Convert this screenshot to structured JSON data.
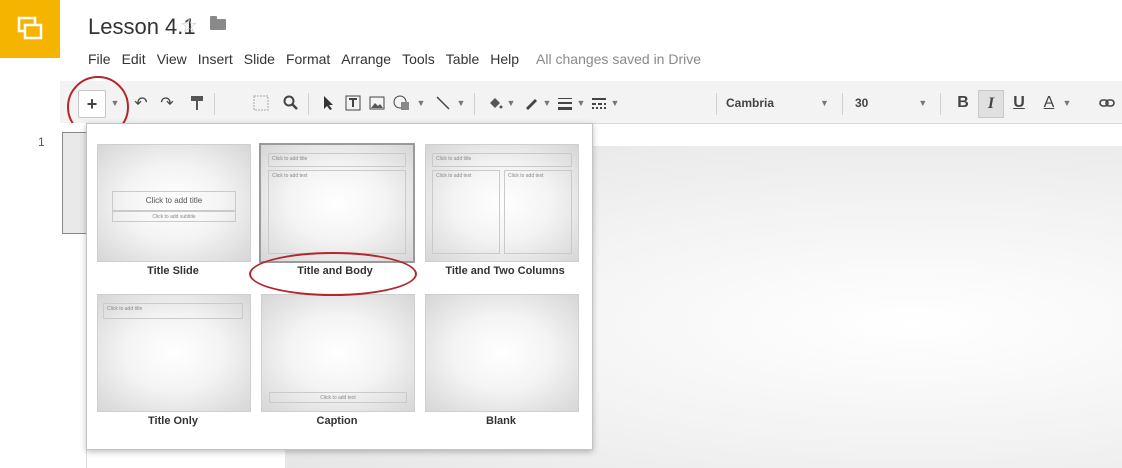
{
  "header": {
    "doc_title": "Lesson 4.1",
    "star_icon": "☆",
    "folder_icon": "folder-icon"
  },
  "menu": {
    "items": [
      "File",
      "Edit",
      "View",
      "Insert",
      "Slide",
      "Format",
      "Arrange",
      "Tools",
      "Table",
      "Help"
    ],
    "status": "All changes saved in Drive"
  },
  "toolbar": {
    "new_slide": "+",
    "undo": "↶",
    "redo": "↷",
    "font": "Cambria",
    "font_size": "30",
    "bold": "B",
    "italic": "I",
    "underline": "U",
    "text_color": "A"
  },
  "filmstrip": {
    "slide_number": "1"
  },
  "layouts": [
    {
      "name": "Title Slide",
      "title_placeholder": "Click to add title",
      "sub_placeholder": "Click to add subtitle"
    },
    {
      "name": "Title and Body",
      "title_placeholder": "Click to add title",
      "body_placeholder": "Click to add text"
    },
    {
      "name": "Title and Two Columns",
      "title_placeholder": "Click to add title",
      "col1_placeholder": "Click to add text",
      "col2_placeholder": "Click to add text"
    },
    {
      "name": "Title Only",
      "title_placeholder": "Click to add title"
    },
    {
      "name": "Caption",
      "caption_placeholder": "Click to add text"
    },
    {
      "name": "Blank"
    }
  ],
  "colors": {
    "logo": "#f4b400",
    "highlight_circle": "#b3262b"
  }
}
